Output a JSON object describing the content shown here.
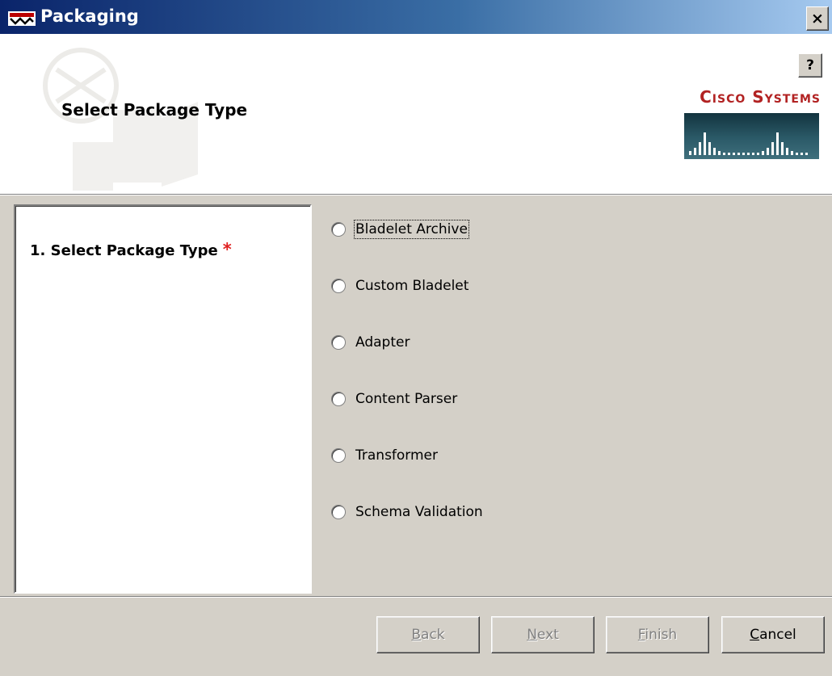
{
  "window": {
    "title": "Packaging",
    "close_label": "×"
  },
  "header": {
    "heading": "Select Package Type",
    "help_label": "?",
    "brand_text": "Cisco Systems"
  },
  "steps": [
    {
      "number": "1.",
      "label": "Select Package Type",
      "required_mark": "*"
    }
  ],
  "options": [
    {
      "label": "Bladelet Archive",
      "selected": false,
      "focused": true
    },
    {
      "label": "Custom Bladelet",
      "selected": false
    },
    {
      "label": "Adapter",
      "selected": false
    },
    {
      "label": "Content Parser",
      "selected": false
    },
    {
      "label": "Transformer",
      "selected": false
    },
    {
      "label": "Schema Validation",
      "selected": false
    }
  ],
  "buttons": {
    "back": {
      "mnemonic": "B",
      "rest": "ack",
      "enabled": false
    },
    "next": {
      "mnemonic": "N",
      "rest": "ext",
      "enabled": false
    },
    "finish": {
      "mnemonic": "F",
      "rest": "inish",
      "enabled": false
    },
    "cancel": {
      "mnemonic": "C",
      "rest": "ancel",
      "enabled": true
    }
  },
  "colors": {
    "title_gradient_start": "#0a246a",
    "brand_red": "#b22222",
    "required": "#e02020",
    "dialog_bg": "#d4d0c8"
  }
}
